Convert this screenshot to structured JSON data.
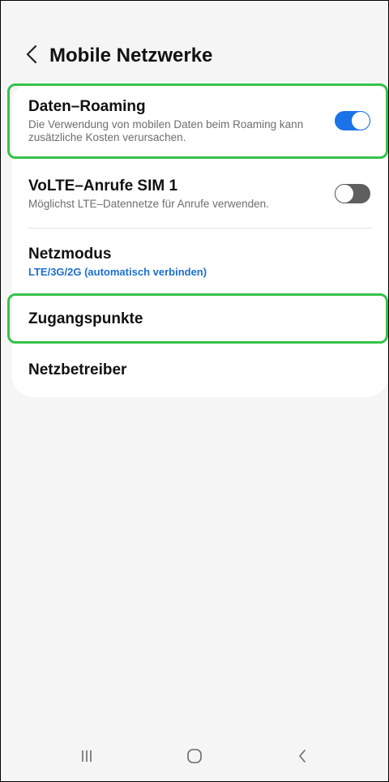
{
  "header": {
    "title": "Mobile Netzwerke",
    "back_icon": "chevron-left-icon"
  },
  "settings": [
    {
      "title": "Daten–Roaming",
      "subtitle": "Die Verwendung von mobilen Daten beim Roaming kann zusätzliche Kosten verursachen.",
      "toggle": "on",
      "highlighted": true
    },
    {
      "title": "VoLTE–Anrufe SIM 1",
      "subtitle": "Möglichst LTE–Datennetze für Anrufe verwenden.",
      "toggle": "off",
      "highlighted": false
    },
    {
      "title": "Netzmodus",
      "subtitle": "LTE/3G/2G (automatisch verbinden)",
      "highlighted": false
    },
    {
      "title": "Zugangspunkte",
      "highlighted": true
    },
    {
      "title": "Netzbetreiber",
      "highlighted": false
    }
  ],
  "nav_bar": {
    "recents_icon": "recents-icon",
    "home_icon": "home-icon",
    "back_icon": "back-icon"
  },
  "colors": {
    "accent": "#1a73e8",
    "link_text": "#1f6fd1",
    "highlight": "#35c24a",
    "background": "#f5f5f5",
    "card": "#ffffff"
  }
}
